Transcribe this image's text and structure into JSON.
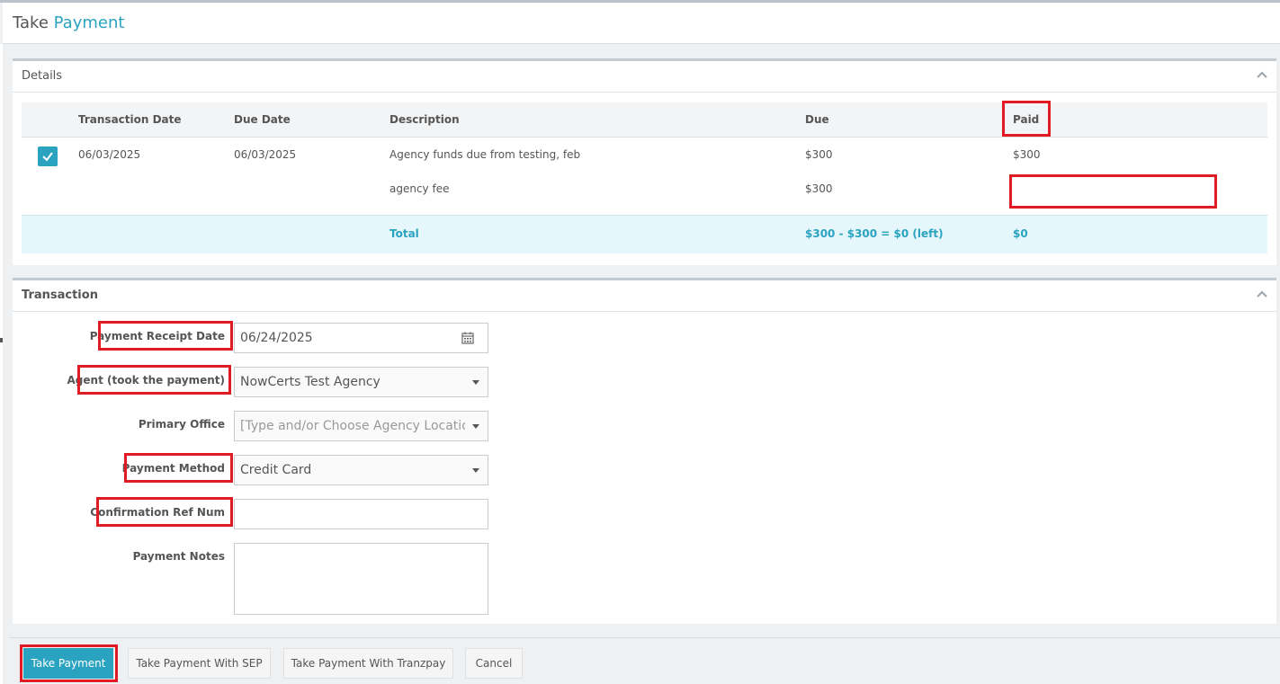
{
  "page": {
    "title_main": "Take",
    "title_accent": "Payment"
  },
  "details": {
    "title": "Details",
    "columns": {
      "transaction_date": "Transaction Date",
      "due_date": "Due Date",
      "description": "Description",
      "due": "Due",
      "paid": "Paid"
    },
    "row": {
      "checked": true,
      "transaction_date": "06/03/2025",
      "due_date": "06/03/2025",
      "description": "Agency funds due from testing, feb",
      "due": "$300",
      "paid": "$300",
      "sub_description": "agency fee",
      "sub_due": "$300",
      "sub_paid": ""
    },
    "total": {
      "label": "Total",
      "due_calc": "$300 - $300 = ",
      "due_left": "$0 (left)",
      "paid": "$0"
    }
  },
  "transaction": {
    "title": "Transaction",
    "payment_receipt_date": {
      "label": "Payment Receipt Date",
      "value": "06/24/2025"
    },
    "agent": {
      "label": "Agent (took the payment)",
      "value": "NowCerts Test Agency"
    },
    "primary_office": {
      "label": "Primary Office",
      "placeholder": "[Type and/or Choose Agency Location]"
    },
    "payment_method": {
      "label": "Payment Method",
      "value": "Credit Card"
    },
    "confirmation_ref": {
      "label": "Confirmation Ref Num",
      "value": ""
    },
    "payment_notes": {
      "label": "Payment Notes",
      "value": ""
    }
  },
  "buttons": {
    "take_payment": "Take Payment",
    "take_payment_sep": "Take Payment With SEP",
    "take_payment_tranzpay": "Take Payment With Tranzpay",
    "cancel": "Cancel"
  },
  "colors": {
    "accent": "#2aa3c0",
    "highlight_box": "#e01b24",
    "total_row_bg": "#e5f7fb"
  }
}
